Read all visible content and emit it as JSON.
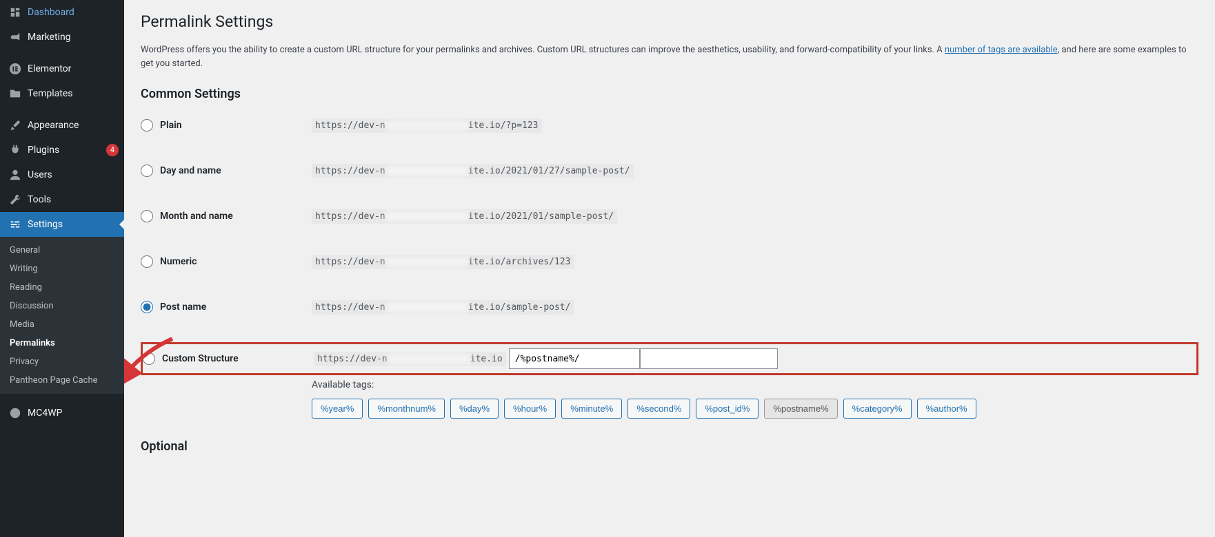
{
  "sidebar": {
    "top_items": [
      {
        "label": "Dashboard",
        "icon": "dashboard"
      },
      {
        "label": "Marketing",
        "icon": "megaphone"
      }
    ],
    "mid_items": [
      {
        "label": "Elementor",
        "icon": "elementor"
      },
      {
        "label": "Templates",
        "icon": "folder"
      }
    ],
    "bottom_items": [
      {
        "label": "Appearance",
        "icon": "brush"
      },
      {
        "label": "Plugins",
        "icon": "plug",
        "badge": "4"
      },
      {
        "label": "Users",
        "icon": "user"
      },
      {
        "label": "Tools",
        "icon": "wrench"
      },
      {
        "label": "Settings",
        "icon": "sliders",
        "active": true
      }
    ],
    "submenu": [
      {
        "label": "General"
      },
      {
        "label": "Writing"
      },
      {
        "label": "Reading"
      },
      {
        "label": "Discussion"
      },
      {
        "label": "Media"
      },
      {
        "label": "Permalinks",
        "current": true
      },
      {
        "label": "Privacy"
      },
      {
        "label": "Pantheon Page Cache"
      }
    ],
    "last_item": {
      "label": "MC4WP",
      "icon": "mailchimp"
    }
  },
  "page": {
    "title": "Permalink Settings",
    "desc_before": "WordPress offers you the ability to create a custom URL structure for your permalinks and archives. Custom URL structures can improve the aesthetics, usability, and forward-compatibility of your links. A ",
    "desc_link": "number of tags are available",
    "desc_after": ", and here are some examples to get you started.",
    "common_heading": "Common Settings",
    "options": [
      {
        "label": "Plain",
        "prefix": "https://dev-n",
        "suffix": "ite.io/?p=123"
      },
      {
        "label": "Day and name",
        "prefix": "https://dev-n",
        "suffix": "ite.io/2021/01/27/sample-post/"
      },
      {
        "label": "Month and name",
        "prefix": "https://dev-n",
        "suffix": "ite.io/2021/01/sample-post/"
      },
      {
        "label": "Numeric",
        "prefix": "https://dev-n",
        "suffix": "ite.io/archives/123"
      },
      {
        "label": "Post name",
        "prefix": "https://dev-n",
        "suffix": "ite.io/sample-post/",
        "checked": true
      }
    ],
    "custom": {
      "label": "Custom Structure",
      "prefix": "https://dev-n",
      "suffix": "ite.io",
      "value": "/%postname%/"
    },
    "available_tags_label": "Available tags:",
    "tags": [
      "%year%",
      "%monthnum%",
      "%day%",
      "%hour%",
      "%minute%",
      "%second%",
      "%post_id%",
      "%postname%",
      "%category%",
      "%author%"
    ],
    "tag_selected": "%postname%",
    "optional_heading": "Optional"
  }
}
